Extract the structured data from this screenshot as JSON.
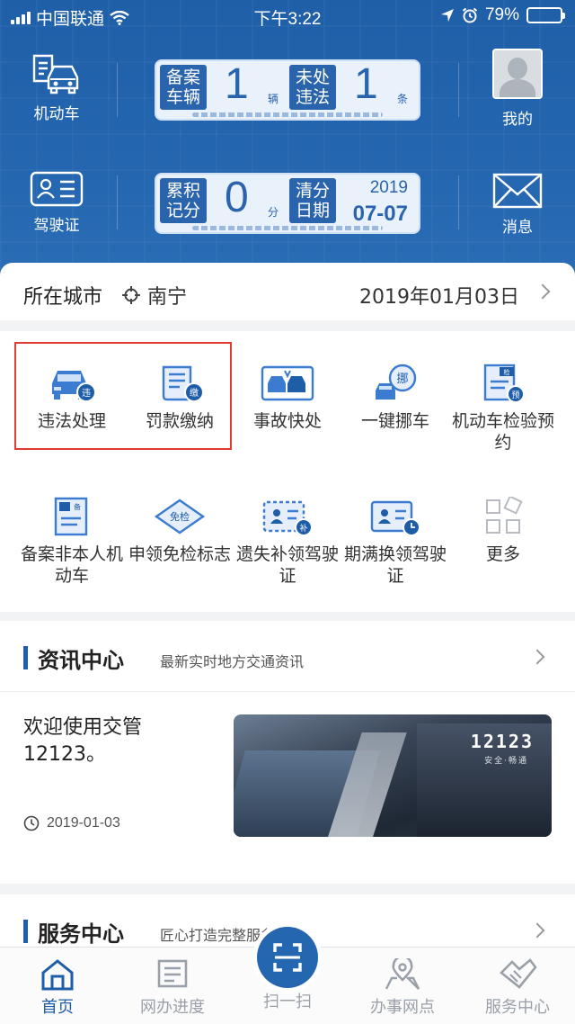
{
  "status_bar": {
    "carrier": "中国联通",
    "time": "下午3:22",
    "battery": "79%",
    "battery_level": 0.79
  },
  "header": {
    "left": [
      {
        "label": "机动车",
        "icon": "car-document-icon"
      },
      {
        "label": "驾驶证",
        "icon": "license-card-icon"
      }
    ],
    "right": [
      {
        "label": "我的",
        "icon": "avatar-icon"
      },
      {
        "label": "消息",
        "icon": "envelope-icon"
      }
    ],
    "vehicle_plate": {
      "registered_label": "备案车辆",
      "registered_count": "1",
      "registered_unit": "辆",
      "violation_label": "未处违法",
      "violation_count": "1",
      "violation_unit": "条"
    },
    "license_plate": {
      "points_label": "累积记分",
      "points": "0",
      "points_unit": "分",
      "clear_label": "清分日期",
      "clear_year": "2019",
      "clear_date": "07-07"
    }
  },
  "city_bar": {
    "label": "所在城市",
    "city": "南宁",
    "date": "2019年01月03日"
  },
  "services": [
    {
      "label": "违法处理",
      "icon": "car-violation-icon"
    },
    {
      "label": "罚款缴纳",
      "icon": "fine-payment-icon"
    },
    {
      "label": "事故快处",
      "icon": "accident-icon"
    },
    {
      "label": "一键挪车",
      "icon": "move-car-icon"
    },
    {
      "label": "机动车检验预约",
      "icon": "inspection-booking-icon"
    },
    {
      "label": "备案非本人机动车",
      "icon": "register-vehicle-icon"
    },
    {
      "label": "申领免检标志",
      "icon": "exempt-badge-icon"
    },
    {
      "label": "遗失补领驾驶证",
      "icon": "reissue-license-icon"
    },
    {
      "label": "期满换领驾驶证",
      "icon": "renew-license-icon"
    },
    {
      "label": "更多",
      "icon": "more-grid-icon"
    }
  ],
  "news_section": {
    "title": "资讯中心",
    "subtitle": "最新实时地方交通资讯",
    "item": {
      "text": "欢迎使用交管12123。",
      "date": "2019-01-03",
      "image_logo": "12123",
      "image_tagline": "安全·畅通"
    }
  },
  "service_section": {
    "title": "服务中心",
    "subtitle": "匠心打造完整服务体系"
  },
  "tab_bar": [
    {
      "label": "首页",
      "icon": "home-icon",
      "active": true
    },
    {
      "label": "网办进度",
      "icon": "progress-icon",
      "active": false
    },
    {
      "label": "扫一扫",
      "icon": "scan-icon",
      "active": false
    },
    {
      "label": "办事网点",
      "icon": "location-icon",
      "active": false
    },
    {
      "label": "服务中心",
      "icon": "handshake-icon",
      "active": false
    }
  ],
  "colors": {
    "header_blue": "#2466b0",
    "accent_blue": "#1e5da8",
    "highlight_red": "#e23b32"
  }
}
